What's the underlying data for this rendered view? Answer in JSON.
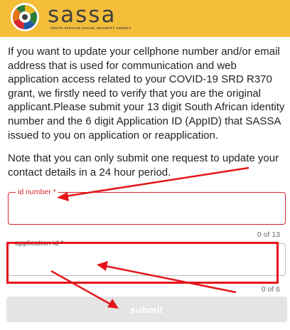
{
  "header": {
    "logo_text": "sassa",
    "logo_subtitle": "SOUTH AFRICAN SOCIAL SECURITY AGENCY",
    "background_color": "#f5be3a"
  },
  "intro_paragraph": "If you want to update your cellphone number and/or email address that is used for communication and web application access related to your COVID-19 SRD R370 grant, we firstly need to verify that you are the original applicant.Please submit your 13 digit South African identity number and the 6 digit Application ID (AppID) that SASSA issued to you on application or reapplication.",
  "note_paragraph": "Note that you can only submit one request to update your contact details in a 24 hour period.",
  "form": {
    "id_number": {
      "label": "id number *",
      "value": "",
      "counter": "0 of 13"
    },
    "application_id": {
      "label": "application id *",
      "value": "",
      "counter": "0 of 6"
    },
    "submit_label": "submit"
  },
  "annotations": {
    "arrow_color": "#e3161b",
    "highlight_box_color": "#e3161b"
  }
}
